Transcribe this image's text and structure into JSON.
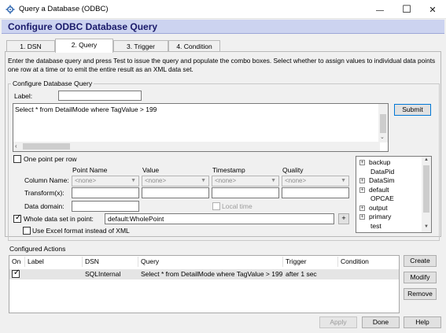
{
  "window": {
    "title": "Query a Database (ODBC)"
  },
  "banner": {
    "title": "Configure ODBC Database Query"
  },
  "tabs": [
    {
      "label": "1. DSN"
    },
    {
      "label": "2. Query"
    },
    {
      "label": "3. Trigger"
    },
    {
      "label": "4. Condition"
    }
  ],
  "description": "Enter the database query and press Test to issue the query and populate the combo boxes.  Select whether to assign values to individual data points one row at a time or to emit the entire result as an XML data set.",
  "query_group": {
    "title": "Configure Database Query",
    "label_caption": "Label:",
    "label_value": "",
    "query_text": "Select * from DetailMode where TagValue > 199",
    "submit_label": "Submit"
  },
  "mapping": {
    "one_point_label": "One point per row",
    "one_point_checked": false,
    "col_headers": [
      "Point Name",
      "Value",
      "Timestamp",
      "Quality"
    ],
    "column_name_label": "Column Name:",
    "transform_label": "Transform(x):",
    "data_domain_label": "Data domain:",
    "combo_value": "<none>",
    "local_time_label": "Local time",
    "whole_set_label": "Whole data set in point:",
    "whole_set_checked": true,
    "whole_set_value": "default:WholePoint",
    "plus_label": "+",
    "excel_label": "Use Excel format instead of XML",
    "excel_checked": false
  },
  "tree": {
    "items": [
      {
        "label": "backup",
        "expandable": true
      },
      {
        "label": "DataPid",
        "expandable": false
      },
      {
        "label": "DataSim",
        "expandable": true
      },
      {
        "label": "default",
        "expandable": true
      },
      {
        "label": "OPCAE",
        "expandable": false
      },
      {
        "label": "output",
        "expandable": true
      },
      {
        "label": "primary",
        "expandable": true
      },
      {
        "label": "test",
        "expandable": false
      }
    ]
  },
  "actions": {
    "title": "Configured Actions",
    "headers": [
      "On",
      "Label",
      "DSN",
      "Query",
      "Trigger",
      "Condition"
    ],
    "rows": [
      {
        "on": true,
        "label": "",
        "dsn": "SQLInternal",
        "query": "Select * from DetailMode where TagValue > 199",
        "trigger": "after 1 sec",
        "condition": ""
      }
    ],
    "create_label": "Create",
    "modify_label": "Modify",
    "remove_label": "Remove"
  },
  "footer": {
    "apply_label": "Apply",
    "done_label": "Done",
    "help_label": "Help"
  },
  "icons": {
    "minimize": "—",
    "maximize": "☐",
    "close": "✕"
  }
}
